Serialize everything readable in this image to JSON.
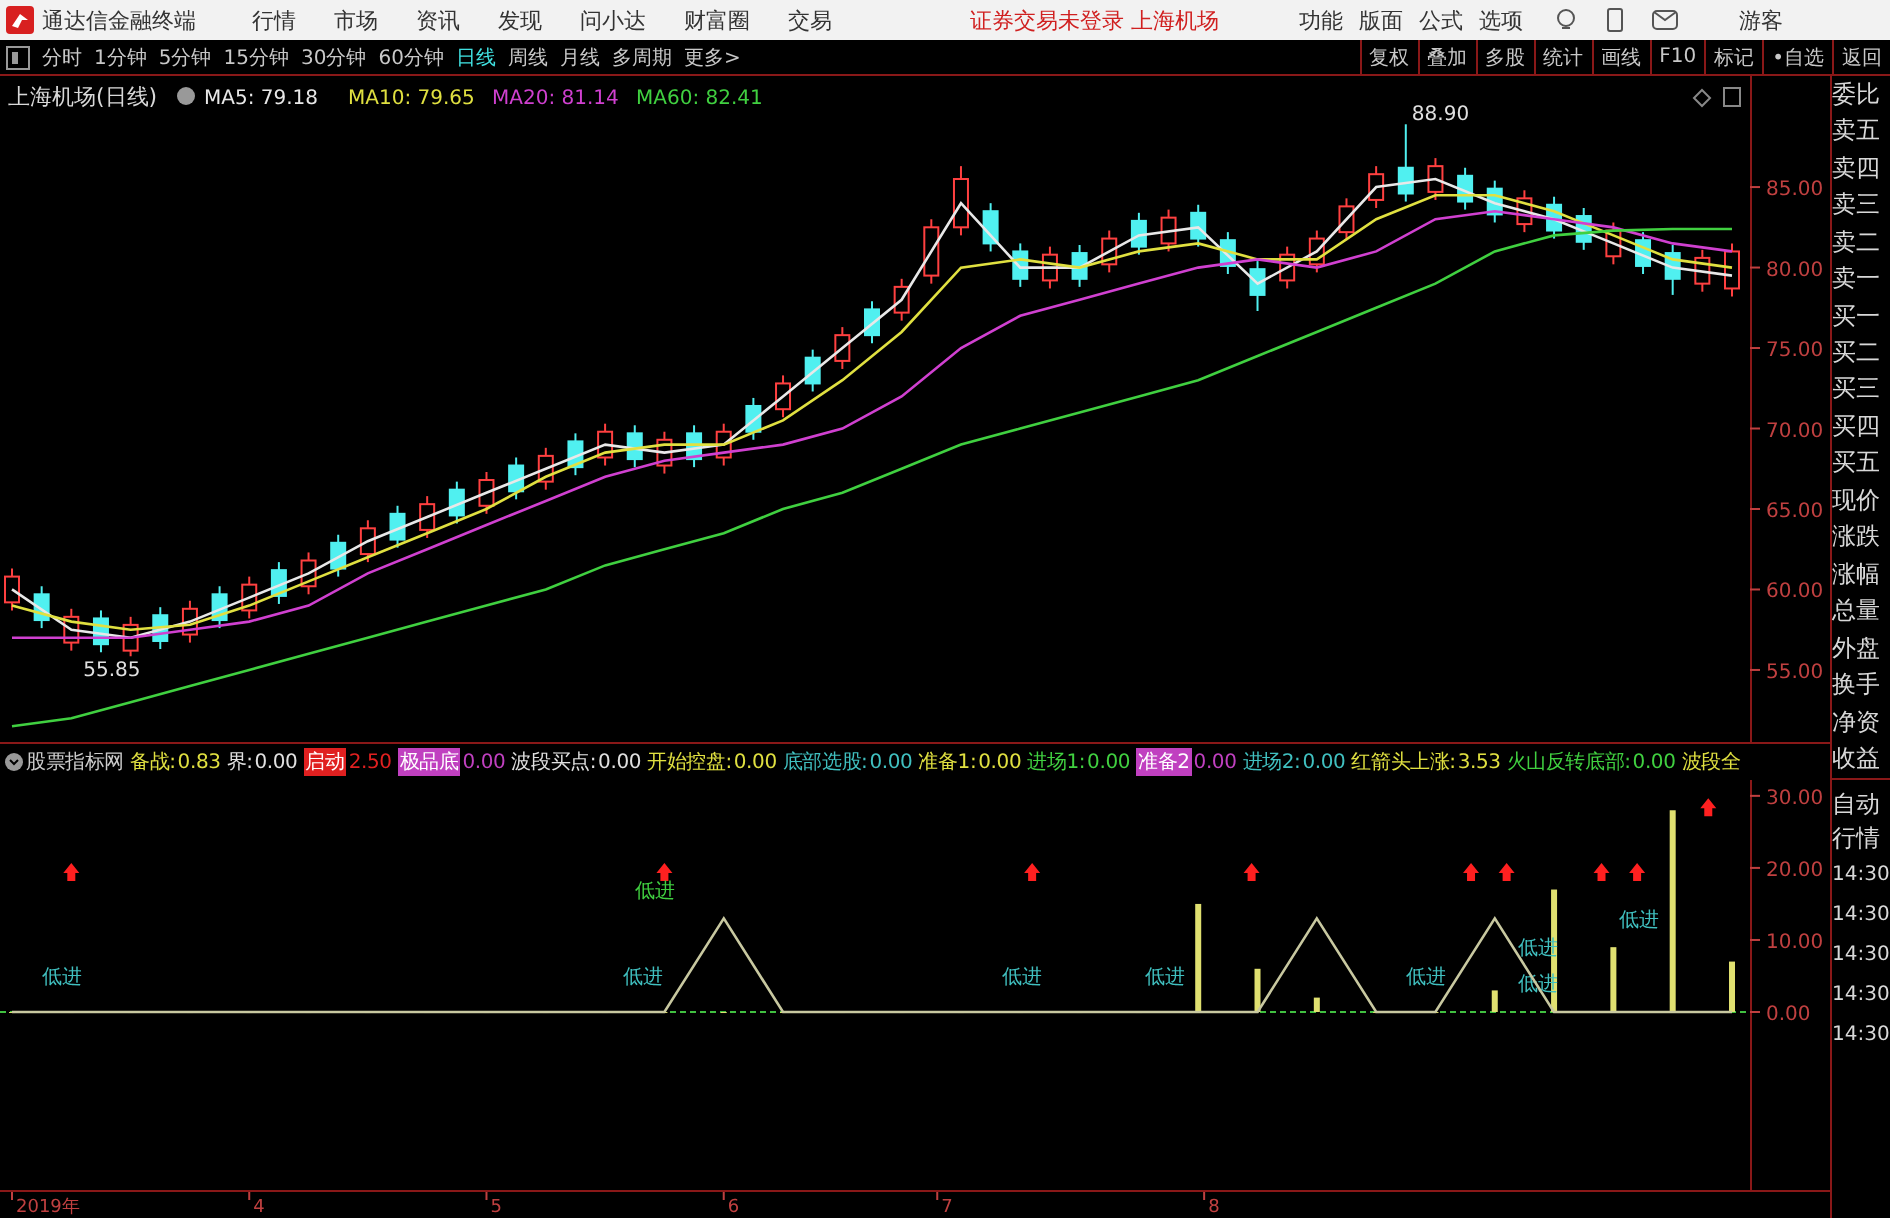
{
  "titlebar": {
    "app_name": "通达信金融终端",
    "menu": [
      "行情",
      "市场",
      "资讯",
      "发现",
      "问小达",
      "财富圈",
      "交易"
    ],
    "status": "证券交易未登录 上海机场",
    "tools": [
      "功能",
      "版面",
      "公式",
      "选项"
    ],
    "user": "游客"
  },
  "periods": [
    {
      "label": "分时",
      "selected": false
    },
    {
      "label": "1分钟",
      "selected": false
    },
    {
      "label": "5分钟",
      "selected": false
    },
    {
      "label": "15分钟",
      "selected": false
    },
    {
      "label": "30分钟",
      "selected": false
    },
    {
      "label": "60分钟",
      "selected": false
    },
    {
      "label": "日线",
      "selected": true
    },
    {
      "label": "周线",
      "selected": false
    },
    {
      "label": "月线",
      "selected": false
    },
    {
      "label": "多周期",
      "selected": false
    },
    {
      "label": "更多>",
      "selected": false
    }
  ],
  "chart_buttons": [
    "复权",
    "叠加",
    "多股",
    "统计",
    "画线",
    "F10",
    "标记",
    "•自选",
    "返回"
  ],
  "main_chart": {
    "title": "上海机场(日线)",
    "legend": [
      {
        "label": "MA5:",
        "value": "79.18",
        "color": "#e8e8e8"
      },
      {
        "label": "MA10:",
        "value": "79.65",
        "color": "#e0e040"
      },
      {
        "label": "MA20:",
        "value": "81.14",
        "color": "#d040d0"
      },
      {
        "label": "MA60:",
        "value": "82.41",
        "color": "#40d040"
      }
    ],
    "chart_data": {
      "type": "line",
      "ylim": [
        50.4,
        91.9
      ],
      "yticks": [
        {
          "value": 85,
          "label": "85.00"
        },
        {
          "value": 80,
          "label": "80.00"
        },
        {
          "value": 75,
          "label": "75.00"
        },
        {
          "value": 70,
          "label": "70.00"
        },
        {
          "value": 65,
          "label": "65.00"
        },
        {
          "value": 60,
          "label": "60.00"
        },
        {
          "value": 55,
          "label": "55.00"
        }
      ],
      "series": [
        {
          "color": "#e8e8e8",
          "values": [
            60,
            57.5,
            57,
            58,
            59.5,
            61,
            63,
            64.5,
            66,
            67.5,
            69,
            68.5,
            69,
            72,
            75,
            78,
            84,
            80,
            80,
            82,
            82.5,
            79,
            81,
            85,
            85.5,
            84,
            83,
            81.5,
            80,
            79.5
          ]
        },
        {
          "color": "#e0e040",
          "values": [
            59,
            58,
            57.5,
            57.8,
            59,
            60.5,
            62,
            63.5,
            65,
            67,
            68.5,
            69,
            69,
            70.5,
            73,
            76,
            80,
            80.5,
            80,
            81,
            81.5,
            80.5,
            80.5,
            83,
            84.5,
            84.5,
            83.5,
            82,
            80.5,
            80
          ]
        },
        {
          "color": "#d040d0",
          "values": [
            57,
            57,
            57,
            57.5,
            58,
            59,
            61,
            62.5,
            64,
            65.5,
            67,
            68,
            68.5,
            69,
            70,
            72,
            75,
            77,
            78,
            79,
            80,
            80.5,
            80,
            81,
            83,
            83.5,
            83,
            82.5,
            81.5,
            81
          ]
        },
        {
          "color": "#40d040",
          "values": [
            51.5,
            52,
            53,
            54,
            55,
            56,
            57,
            58,
            59,
            60,
            61.5,
            62.5,
            63.5,
            65,
            66,
            67.5,
            69,
            70,
            71,
            72,
            73,
            74.5,
            76,
            77.5,
            79,
            81,
            82,
            82.3,
            82.4,
            82.4
          ]
        }
      ]
    },
    "price_marks": [
      "88.90",
      "55.85"
    ],
    "candles": {
      "chart_data": {
        "type": "candlestick",
        "ohlc": [
          [
            59.2,
            61.3,
            58.7,
            60.8
          ],
          [
            59.7,
            60.2,
            57.6,
            58.1
          ],
          [
            56.7,
            58.8,
            56.2,
            58.3
          ],
          [
            58.2,
            58.7,
            56.1,
            56.6
          ],
          [
            56.2,
            58.3,
            55.85,
            57.8
          ],
          [
            58.4,
            58.9,
            56.3,
            56.8
          ],
          [
            57.2,
            59.3,
            56.7,
            58.8
          ],
          [
            59.7,
            60.2,
            57.6,
            58.1
          ],
          [
            58.7,
            60.8,
            58.2,
            60.3
          ],
          [
            61.2,
            61.7,
            59.1,
            59.6
          ],
          [
            60.2,
            62.3,
            59.7,
            61.8
          ],
          [
            62.9,
            63.4,
            60.8,
            61.3
          ],
          [
            62.2,
            64.3,
            61.7,
            63.8
          ],
          [
            64.7,
            65.2,
            62.6,
            63.1
          ],
          [
            63.7,
            65.8,
            63.2,
            65.3
          ],
          [
            66.2,
            66.7,
            64.1,
            64.6
          ],
          [
            65.2,
            67.3,
            64.7,
            66.8
          ],
          [
            67.7,
            68.2,
            65.6,
            66.1
          ],
          [
            66.7,
            68.8,
            66.2,
            68.3
          ],
          [
            69.2,
            69.7,
            67.1,
            67.6
          ],
          [
            68.2,
            70.3,
            67.7,
            69.8
          ],
          [
            69.7,
            70.2,
            67.6,
            68.1
          ],
          [
            67.7,
            69.8,
            67.2,
            69.3
          ],
          [
            69.7,
            70.2,
            67.6,
            68.1
          ],
          [
            68.2,
            70.3,
            67.7,
            69.8
          ],
          [
            71.4,
            71.9,
            69.3,
            69.8
          ],
          [
            71.2,
            73.3,
            70.7,
            72.8
          ],
          [
            74.4,
            74.9,
            72.3,
            72.8
          ],
          [
            74.2,
            76.3,
            73.7,
            75.8
          ],
          [
            77.4,
            77.9,
            75.3,
            75.8
          ],
          [
            77.2,
            79.3,
            76.7,
            78.8
          ],
          [
            79.5,
            83,
            79,
            82.5
          ],
          [
            82.5,
            86.3,
            82,
            85.5
          ],
          [
            83.5,
            84,
            81,
            81.5
          ],
          [
            81,
            81.5,
            78.8,
            79.3
          ],
          [
            79.2,
            81.3,
            78.7,
            80.8
          ],
          [
            80.9,
            81.4,
            78.8,
            79.3
          ],
          [
            80.2,
            82.3,
            79.7,
            81.8
          ],
          [
            82.9,
            83.4,
            80.8,
            81.3
          ],
          [
            81.5,
            83.6,
            81,
            83.1
          ],
          [
            83.4,
            83.9,
            81.3,
            81.8
          ],
          [
            81.7,
            82.2,
            79.6,
            80.1
          ],
          [
            79.9,
            80.4,
            77.3,
            78.3
          ],
          [
            79.2,
            81.3,
            78.7,
            80.8
          ],
          [
            80.2,
            82.3,
            79.7,
            81.8
          ],
          [
            82.2,
            84.3,
            81.7,
            83.8
          ],
          [
            84.2,
            86.3,
            83.7,
            85.8
          ],
          [
            86.2,
            88.9,
            84.1,
            84.6
          ],
          [
            84.7,
            86.8,
            84.2,
            86.3
          ],
          [
            85.7,
            86.2,
            83.6,
            84.1
          ],
          [
            84.9,
            85.4,
            82.8,
            83.3
          ],
          [
            82.7,
            84.8,
            82.2,
            84.3
          ],
          [
            83.9,
            84.4,
            81.8,
            82.3
          ],
          [
            83.2,
            83.7,
            81.1,
            81.6
          ],
          [
            80.7,
            82.8,
            80.2,
            82.3
          ],
          [
            81.7,
            82.2,
            79.6,
            80.1
          ],
          [
            80.9,
            81.4,
            78.3,
            79.3
          ],
          [
            79,
            81.1,
            78.5,
            80.6
          ],
          [
            78.7,
            81.5,
            78.2,
            81
          ]
        ]
      }
    }
  },
  "indicator": {
    "name": "股票指标网",
    "legend": [
      {
        "label": "备战:",
        "value": "0.83",
        "color": "#e0e040",
        "boxed": false
      },
      {
        "label": "界:",
        "value": "0.00",
        "color": "#e0e0e0",
        "boxed": false
      },
      {
        "label": "启动",
        "value": "2.50",
        "color": "#e02020",
        "boxed": true
      },
      {
        "label": "极品底",
        "value": "0.00",
        "color": "#c040c0",
        "boxed": true
      },
      {
        "label": "波段买点:",
        "value": "0.00",
        "color": "#e0e0e0",
        "boxed": false
      },
      {
        "label": "开始控盘:",
        "value": "0.00",
        "color": "#e0e040",
        "boxed": false
      },
      {
        "label": "底部选股:",
        "value": "0.00",
        "color": "#40c0c0",
        "boxed": false
      },
      {
        "label": "准备1:",
        "value": "0.00",
        "color": "#e0e040",
        "boxed": false
      },
      {
        "label": "进场1:",
        "value": "0.00",
        "color": "#40d040",
        "boxed": false
      },
      {
        "label": "准备2",
        "value": "0.00",
        "color": "#c040c0",
        "boxed": true
      },
      {
        "label": "进场2:",
        "value": "0.00",
        "color": "#40c0c0",
        "boxed": false
      },
      {
        "label": "红箭头上涨:",
        "value": "3.53",
        "color": "#e0e040",
        "boxed": false
      },
      {
        "label": "火山反转底部:",
        "value": "0.00",
        "color": "#40d040",
        "boxed": false
      },
      {
        "label": "波段全",
        "color": "#e0e040",
        "boxed": false
      }
    ],
    "chart_data": {
      "type": "line",
      "ylim": [
        -24.7,
        32.2
      ],
      "yticks": [
        {
          "value": 30,
          "label": "30.00"
        },
        {
          "value": 20,
          "label": "20.00"
        },
        {
          "value": 10,
          "label": "10.00"
        },
        {
          "value": 0,
          "label": "0.00"
        }
      ],
      "series": [
        {
          "color": "#c8c8a0",
          "values": [
            0,
            0,
            0,
            0,
            0,
            0,
            0,
            0,
            0,
            0,
            0,
            0,
            13,
            0,
            0,
            0,
            0,
            0,
            0,
            0,
            0,
            0,
            13,
            0,
            0,
            13,
            0,
            0,
            0,
            0
          ]
        }
      ]
    },
    "signals": [
      {
        "label": "低进",
        "color": "#40c0c0"
      },
      {
        "label": "低进",
        "color": "#40d040"
      },
      {
        "label": "低进",
        "color": "#40c0c0"
      },
      {
        "label": "低进",
        "color": "#40c0c0"
      },
      {
        "label": "低进",
        "color": "#40c0c0"
      },
      {
        "label": "低进",
        "color": "#40c0c0"
      },
      {
        "label": "低进",
        "color": "#40c0c0"
      },
      {
        "label": "低进",
        "color": "#40c0c0"
      },
      {
        "label": "低进",
        "color": "#40c0c0"
      }
    ],
    "date_axis": [
      "2019年",
      "4",
      "5",
      "6",
      "7",
      "8"
    ]
  },
  "quote_panel": {
    "fields": [
      "委比",
      "卖五",
      "卖四",
      "卖三",
      "卖二",
      "卖一",
      "买一",
      "买二",
      "买三",
      "买四",
      "买五",
      "现价",
      "涨跌",
      "涨幅",
      "总量",
      "外盘",
      "换手",
      "净资",
      "收益"
    ],
    "lower": [
      "自动",
      "行情"
    ],
    "times": [
      "14:30",
      "14:30",
      "14:30",
      "14:30",
      "14:30"
    ]
  }
}
